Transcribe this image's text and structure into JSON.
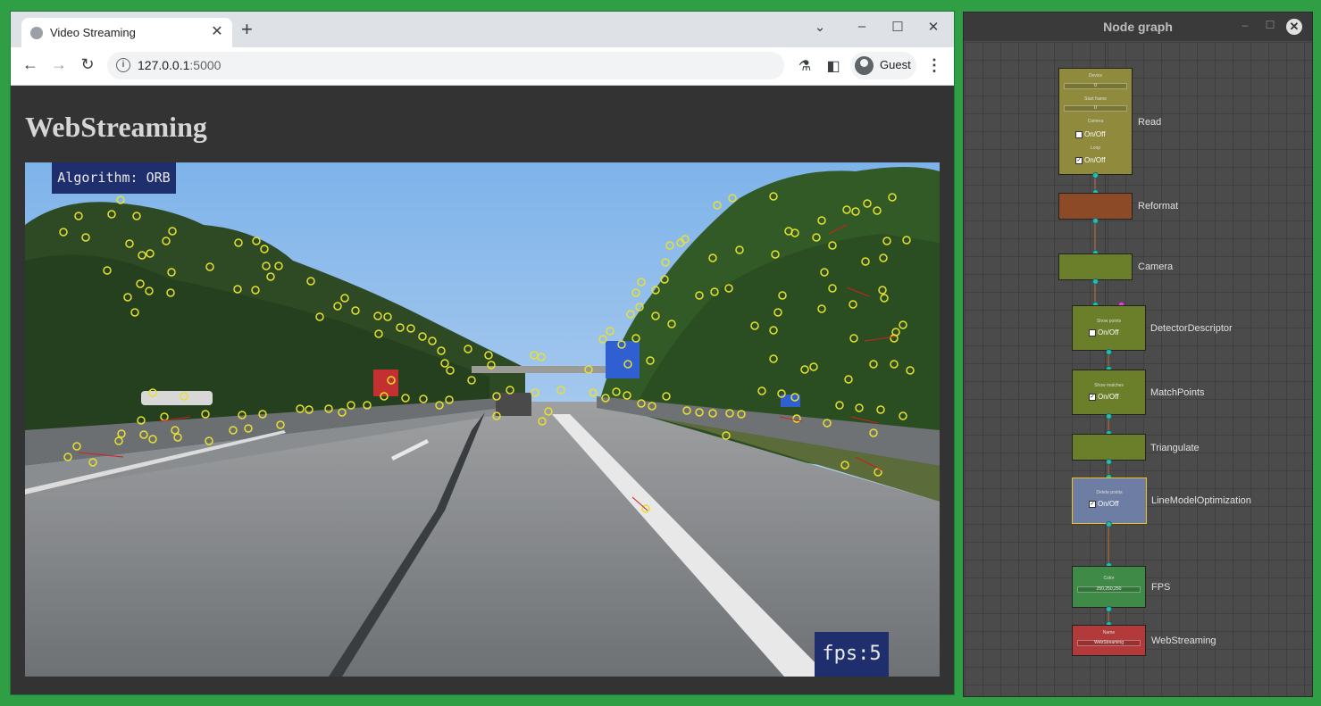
{
  "browser": {
    "tab_title": "Video Streaming",
    "new_tab": "+",
    "url_host": "127.0.0.1",
    "url_rest": ":5000",
    "profile_name": "Guest",
    "window_controls": {
      "dropdown": "⌄",
      "minimize": "–",
      "maximize": "☐",
      "close": "✕"
    }
  },
  "page": {
    "heading": "WebStreaming",
    "overlay_algorithm": "Algorithm: ORB",
    "overlay_fps": "fps:5"
  },
  "node_graph": {
    "title": "Node graph",
    "window_controls": {
      "minimize": "–",
      "maximize": "☐",
      "close": "✕"
    },
    "nodes": [
      {
        "name": "Read",
        "color": "#8f8a3c",
        "fields": [
          "Device",
          "0",
          "Start frame",
          "0",
          "Camera",
          "Loop"
        ],
        "checkboxes": [
          {
            "label": "On/Off",
            "checked": false
          },
          {
            "label": "On/Off",
            "checked": true
          }
        ]
      },
      {
        "name": "Reformat",
        "color": "#8c4a26"
      },
      {
        "name": "Camera",
        "color": "#6b7f2a"
      },
      {
        "name": "DetectorDescriptor",
        "color": "#6b7f2a",
        "fields": [
          "Show points"
        ],
        "checkboxes": [
          {
            "label": "On/Off",
            "checked": false
          }
        ]
      },
      {
        "name": "MatchPoints",
        "color": "#6b7f2a",
        "fields": [
          "Show matches"
        ],
        "checkboxes": [
          {
            "label": "On/Off",
            "checked": true
          }
        ]
      },
      {
        "name": "Triangulate",
        "color": "#6b7f2a"
      },
      {
        "name": "LineModelOptimization",
        "color": "#6e7da3",
        "fields": [
          "Delete points"
        ],
        "checkboxes": [
          {
            "label": "On/Off",
            "checked": true
          }
        ]
      },
      {
        "name": "FPS",
        "color": "#3f8a46",
        "fields": [
          "Color",
          "250,250,250"
        ]
      },
      {
        "name": "WebStreaming",
        "color": "#b23a3a",
        "fields": [
          "Name",
          "WebStreaming"
        ]
      }
    ]
  },
  "colors": {
    "desktop": "#2f9e44",
    "page_bg": "#333333",
    "overlay_bg": "#1f2f6e"
  }
}
